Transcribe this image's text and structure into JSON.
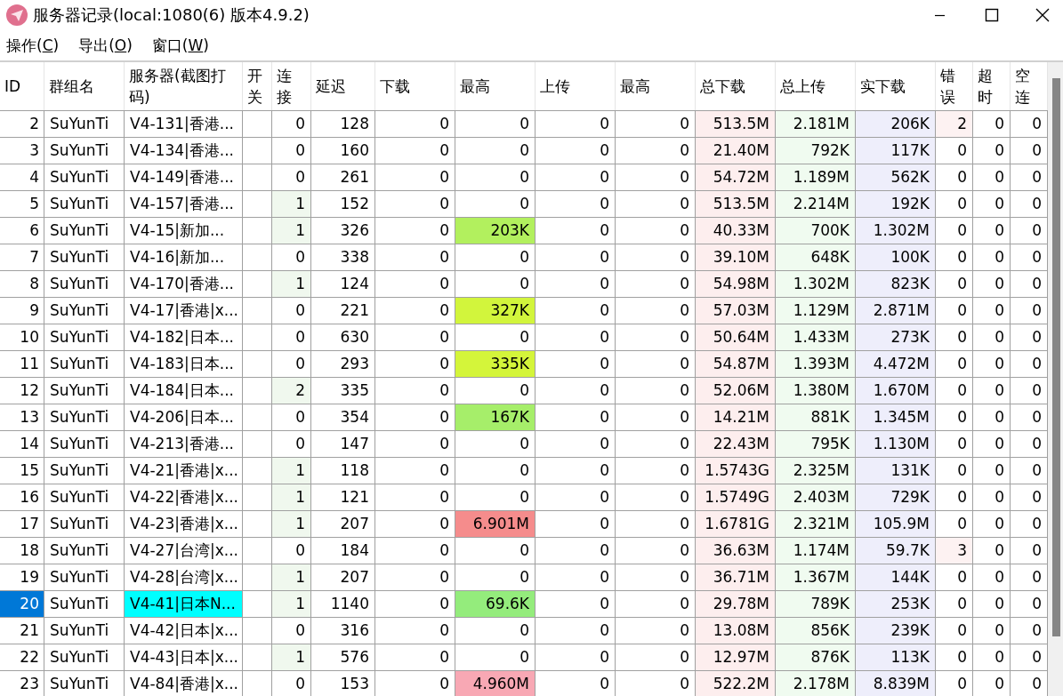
{
  "window": {
    "title": "服务器记录(local:1080(6) 版本4.9.2)"
  },
  "menu": [
    {
      "label": "操作(C)"
    },
    {
      "label": "导出(O)"
    },
    {
      "label": "窗口(W)"
    }
  ],
  "table": {
    "columns": [
      {
        "label": "ID"
      },
      {
        "label": "群组名"
      },
      {
        "label": "服务器(截图打码)"
      },
      {
        "label": "开关"
      },
      {
        "label": "连接"
      },
      {
        "label": "延迟"
      },
      {
        "label": "下载"
      },
      {
        "label": "最高"
      },
      {
        "label": "上传"
      },
      {
        "label": "最高"
      },
      {
        "label": "总下载",
        "color": "#fdeeee"
      },
      {
        "label": "总上传",
        "color": "#f0fbf0"
      },
      {
        "label": "实下载",
        "color": "#eeeefb"
      },
      {
        "label": "错误"
      },
      {
        "label": "超时"
      },
      {
        "label": "空连"
      }
    ],
    "rows": [
      {
        "selected": false,
        "cells": [
          "2",
          "SuYunTi",
          "V4-131|香港...",
          "",
          "0",
          "128",
          "0",
          "0",
          "0",
          "0",
          "513.5M",
          "2.181M",
          "206K",
          {
            "text": "2",
            "color": "#fdf2f2"
          },
          "0",
          "0"
        ]
      },
      {
        "selected": false,
        "cells": [
          "3",
          "SuYunTi",
          "V4-134|香港...",
          "",
          "0",
          "160",
          "0",
          "0",
          "0",
          "0",
          "21.40M",
          "792K",
          "117K",
          "0",
          "0",
          "0"
        ]
      },
      {
        "selected": false,
        "cells": [
          "4",
          "SuYunTi",
          "V4-149|香港...",
          "",
          "0",
          "261",
          "0",
          "0",
          "0",
          "0",
          "54.72M",
          "1.189M",
          "562K",
          "0",
          "0",
          "0"
        ]
      },
      {
        "selected": false,
        "cells": [
          "5",
          "SuYunTi",
          "V4-157|香港...",
          "",
          {
            "text": "1",
            "color": "#f0f8ee"
          },
          "152",
          "0",
          "0",
          "0",
          "0",
          "513.5M",
          "2.214M",
          "192K",
          "0",
          "0",
          "0"
        ]
      },
      {
        "selected": false,
        "cells": [
          "6",
          "SuYunTi",
          "V4-15|新加...",
          "",
          {
            "text": "1",
            "color": "#f0f8ee"
          },
          "326",
          "0",
          {
            "text": "203K",
            "color": "#b2f05e"
          },
          "0",
          "0",
          "40.33M",
          "700K",
          "1.302M",
          "0",
          "0",
          "0"
        ]
      },
      {
        "selected": false,
        "cells": [
          "7",
          "SuYunTi",
          "V4-16|新加...",
          "",
          "0",
          "338",
          "0",
          "0",
          "0",
          "0",
          "39.10M",
          "648K",
          "100K",
          "0",
          "0",
          "0"
        ]
      },
      {
        "selected": false,
        "cells": [
          "8",
          "SuYunTi",
          "V4-170|香港...",
          "",
          {
            "text": "1",
            "color": "#f0f8ee"
          },
          "124",
          "0",
          "0",
          "0",
          "0",
          "54.98M",
          "1.302M",
          "823K",
          "0",
          "0",
          "0"
        ]
      },
      {
        "selected": false,
        "cells": [
          "9",
          "SuYunTi",
          "V4-17|香港|x...",
          "",
          "0",
          "221",
          "0",
          {
            "text": "327K",
            "color": "#d2f53c"
          },
          "0",
          "0",
          "57.03M",
          "1.129M",
          "2.871M",
          "0",
          "0",
          "0"
        ]
      },
      {
        "selected": false,
        "cells": [
          "10",
          "SuYunTi",
          "V4-182|日本...",
          "",
          "0",
          "630",
          "0",
          "0",
          "0",
          "0",
          "50.64M",
          "1.433M",
          "273K",
          "0",
          "0",
          "0"
        ]
      },
      {
        "selected": false,
        "cells": [
          "11",
          "SuYunTi",
          "V4-183|日本...",
          "",
          "0",
          "293",
          "0",
          {
            "text": "335K",
            "color": "#d4f53a"
          },
          "0",
          "0",
          "54.87M",
          "1.393M",
          "4.472M",
          "0",
          "0",
          "0"
        ]
      },
      {
        "selected": false,
        "cells": [
          "12",
          "SuYunTi",
          "V4-184|日本...",
          "",
          {
            "text": "2",
            "color": "#f0f8ee"
          },
          "335",
          "0",
          "0",
          "0",
          "0",
          "52.06M",
          "1.380M",
          "1.670M",
          "0",
          "0",
          "0"
        ]
      },
      {
        "selected": false,
        "cells": [
          "13",
          "SuYunTi",
          "V4-206|日本...",
          "",
          "0",
          "354",
          "0",
          {
            "text": "167K",
            "color": "#a6ee6a"
          },
          "0",
          "0",
          "14.21M",
          "881K",
          "1.345M",
          "0",
          "0",
          "0"
        ]
      },
      {
        "selected": false,
        "cells": [
          "14",
          "SuYunTi",
          "V4-213|香港...",
          "",
          "0",
          "147",
          "0",
          "0",
          "0",
          "0",
          "22.43M",
          "795K",
          "1.130M",
          "0",
          "0",
          "0"
        ]
      },
      {
        "selected": false,
        "cells": [
          "15",
          "SuYunTi",
          "V4-21|香港|x...",
          "",
          {
            "text": "1",
            "color": "#f0f8ee"
          },
          "118",
          "0",
          "0",
          "0",
          "0",
          "1.5743G",
          "2.325M",
          "131K",
          "0",
          "0",
          "0"
        ]
      },
      {
        "selected": false,
        "cells": [
          "16",
          "SuYunTi",
          "V4-22|香港|x...",
          "",
          {
            "text": "1",
            "color": "#f0f8ee"
          },
          "121",
          "0",
          "0",
          "0",
          "0",
          "1.5749G",
          "2.403M",
          "729K",
          "0",
          "0",
          "0"
        ]
      },
      {
        "selected": false,
        "cells": [
          "17",
          "SuYunTi",
          "V4-23|香港|x...",
          "",
          {
            "text": "1",
            "color": "#f0f8ee"
          },
          "207",
          "0",
          {
            "text": "6.901M",
            "color": "#f58c8c"
          },
          "0",
          "0",
          "1.6781G",
          "2.321M",
          "105.9M",
          "0",
          "0",
          "0"
        ]
      },
      {
        "selected": false,
        "cells": [
          "18",
          "SuYunTi",
          "V4-27|台湾|x...",
          "",
          "0",
          "184",
          "0",
          "0",
          "0",
          "0",
          "36.63M",
          "1.174M",
          "59.7K",
          {
            "text": "3",
            "color": "#fdf2f2"
          },
          "0",
          "0"
        ]
      },
      {
        "selected": false,
        "cells": [
          "19",
          "SuYunTi",
          "V4-28|台湾|x...",
          "",
          {
            "text": "1",
            "color": "#f0f8ee"
          },
          "207",
          "0",
          "0",
          "0",
          "0",
          "36.71M",
          "1.367M",
          "144K",
          "0",
          "0",
          "0"
        ]
      },
      {
        "selected": true,
        "cells": [
          "20",
          "SuYunTi",
          {
            "text": "V4-41|日本N...",
            "color": "#00ffff"
          },
          "",
          {
            "text": "1",
            "color": "#f0f8ee"
          },
          "1140",
          "0",
          {
            "text": "69.6K",
            "color": "#94ec7c"
          },
          "0",
          "0",
          "29.78M",
          "789K",
          "253K",
          "0",
          "0",
          "0"
        ]
      },
      {
        "selected": false,
        "cells": [
          "21",
          "SuYunTi",
          "V4-42|日本|x...",
          "",
          "0",
          "316",
          "0",
          "0",
          "0",
          "0",
          "13.08M",
          "856K",
          "239K",
          "0",
          "0",
          "0"
        ]
      },
      {
        "selected": false,
        "cells": [
          "22",
          "SuYunTi",
          "V4-43|日本|x...",
          "",
          {
            "text": "1",
            "color": "#f0f8ee"
          },
          "576",
          "0",
          "0",
          "0",
          "0",
          "12.97M",
          "876K",
          "113K",
          "0",
          "0",
          "0"
        ]
      },
      {
        "selected": false,
        "cells": [
          "23",
          "SuYunTi",
          "V4-84|香港|x...",
          "",
          "0",
          "153",
          "0",
          {
            "text": "4.960M",
            "color": "#f8a8b4"
          },
          "0",
          "0",
          "522.2M",
          "2.178M",
          "8.839M",
          "0",
          "0",
          "0"
        ]
      }
    ]
  }
}
